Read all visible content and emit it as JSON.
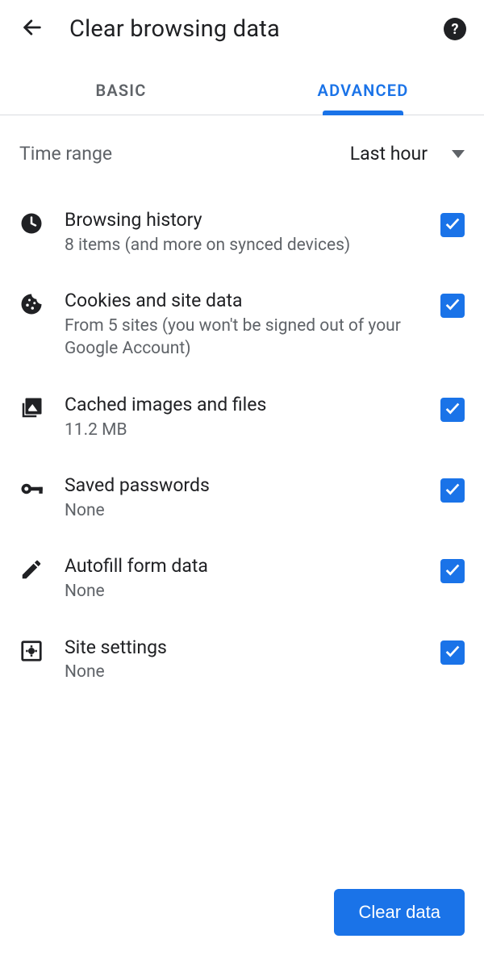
{
  "header": {
    "title": "Clear browsing data"
  },
  "tabs": {
    "basic": "BASIC",
    "advanced": "ADVANCED",
    "active": "advanced"
  },
  "time_range": {
    "label": "Time range",
    "value": "Last hour"
  },
  "items": [
    {
      "icon": "clock-icon",
      "title": "Browsing history",
      "subtitle": "8 items (and more on synced devices)",
      "checked": true
    },
    {
      "icon": "cookie-icon",
      "title": "Cookies and site data",
      "subtitle": "From 5 sites (you won't be signed out of your Google Account)",
      "checked": true
    },
    {
      "icon": "image-stack-icon",
      "title": "Cached images and files",
      "subtitle": "11.2 MB",
      "checked": true
    },
    {
      "icon": "key-icon",
      "title": "Saved passwords",
      "subtitle": "None",
      "checked": true
    },
    {
      "icon": "pencil-icon",
      "title": "Autofill form data",
      "subtitle": "None",
      "checked": true
    },
    {
      "icon": "settings-page-icon",
      "title": "Site settings",
      "subtitle": "None",
      "checked": true
    }
  ],
  "footer": {
    "clear_button": "Clear data"
  },
  "colors": {
    "accent": "#1a73e8",
    "text_primary": "#202124",
    "text_secondary": "#5f6368"
  }
}
